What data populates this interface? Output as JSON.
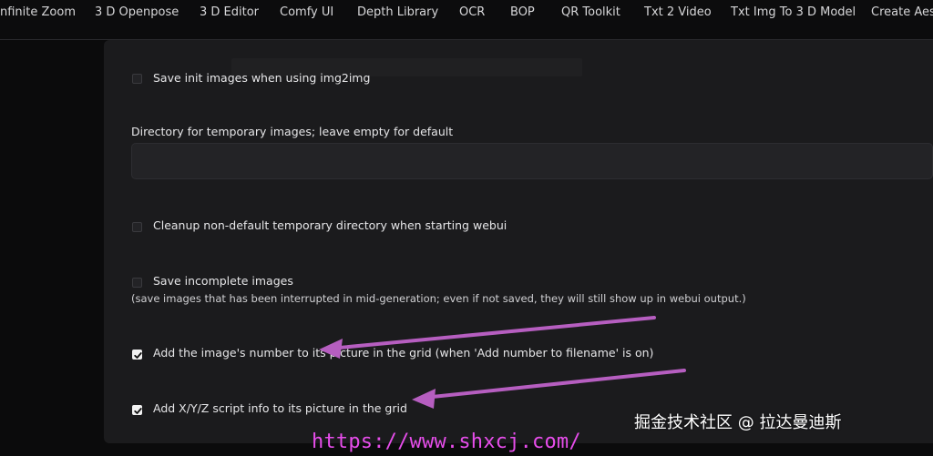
{
  "tabs": [
    {
      "label": "nfinite Zoom"
    },
    {
      "label": "3 D Openpose"
    },
    {
      "label": "3 D Editor"
    },
    {
      "label": "Comfy UI"
    },
    {
      "label": "Depth Library"
    },
    {
      "label": "OCR"
    },
    {
      "label": "BOP"
    },
    {
      "label": "QR Toolkit"
    },
    {
      "label": "Txt 2 Video"
    },
    {
      "label": "Txt Img To 3 D Model"
    },
    {
      "label": "Create Aest"
    }
  ],
  "settings": {
    "save_init": {
      "label": "Save init images when using img2img",
      "checked": false
    },
    "temp_dir": {
      "label": "Directory for temporary images; leave empty for default",
      "value": ""
    },
    "cleanup_temp": {
      "label": "Cleanup non-default temporary directory when starting webui",
      "checked": false
    },
    "save_incomplete": {
      "label": "Save incomplete images",
      "hint": "(save images that has been interrupted in mid-generation; even if not saved, they will still show up in webui output.)",
      "checked": false
    },
    "grid_number": {
      "label": "Add the image's number to its picture in the grid (when 'Add number to filename' is on)",
      "checked": true
    },
    "grid_xyz": {
      "label": "Add X/Y/Z script info to its picture in the grid",
      "checked": true
    }
  },
  "annotation_color": "#b65ec0",
  "watermark": {
    "cn_text": "掘金技术社区 @ 拉达曼迪斯",
    "url": "https://www.shxcj.com/",
    "url_color": "#e64dea"
  }
}
